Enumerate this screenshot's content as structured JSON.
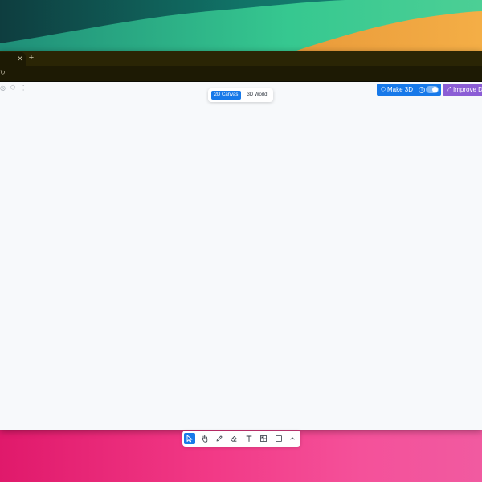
{
  "colors": {
    "accent": "#1779e9",
    "improve": "#8b5dd5",
    "browser_frame": "#2a2505",
    "canvas_bg": "#f7f9fb",
    "wallpaper_top": [
      "#0f4a4a",
      "#2fc08f",
      "#f2a13c"
    ],
    "wallpaper_bottom": "#e8287a"
  },
  "browser": {
    "tab_close_icon": "close-icon",
    "new_tab_label": "+"
  },
  "mode_switch": {
    "active_label": "2D Canvas",
    "other_label": "3D World"
  },
  "header": {
    "make3d_label": "Make 3D",
    "improve_label": "Improve D"
  },
  "toolbar": {
    "tools": [
      {
        "icon": "cursor-icon",
        "active": true
      },
      {
        "icon": "hand-icon",
        "active": false
      },
      {
        "icon": "pencil-icon",
        "active": false
      },
      {
        "icon": "eraser-icon",
        "active": false
      },
      {
        "icon": "text-icon",
        "active": false
      },
      {
        "icon": "image-icon",
        "active": false
      },
      {
        "icon": "rectangle-icon",
        "active": false
      },
      {
        "icon": "chevron-up-icon",
        "active": false
      }
    ]
  }
}
